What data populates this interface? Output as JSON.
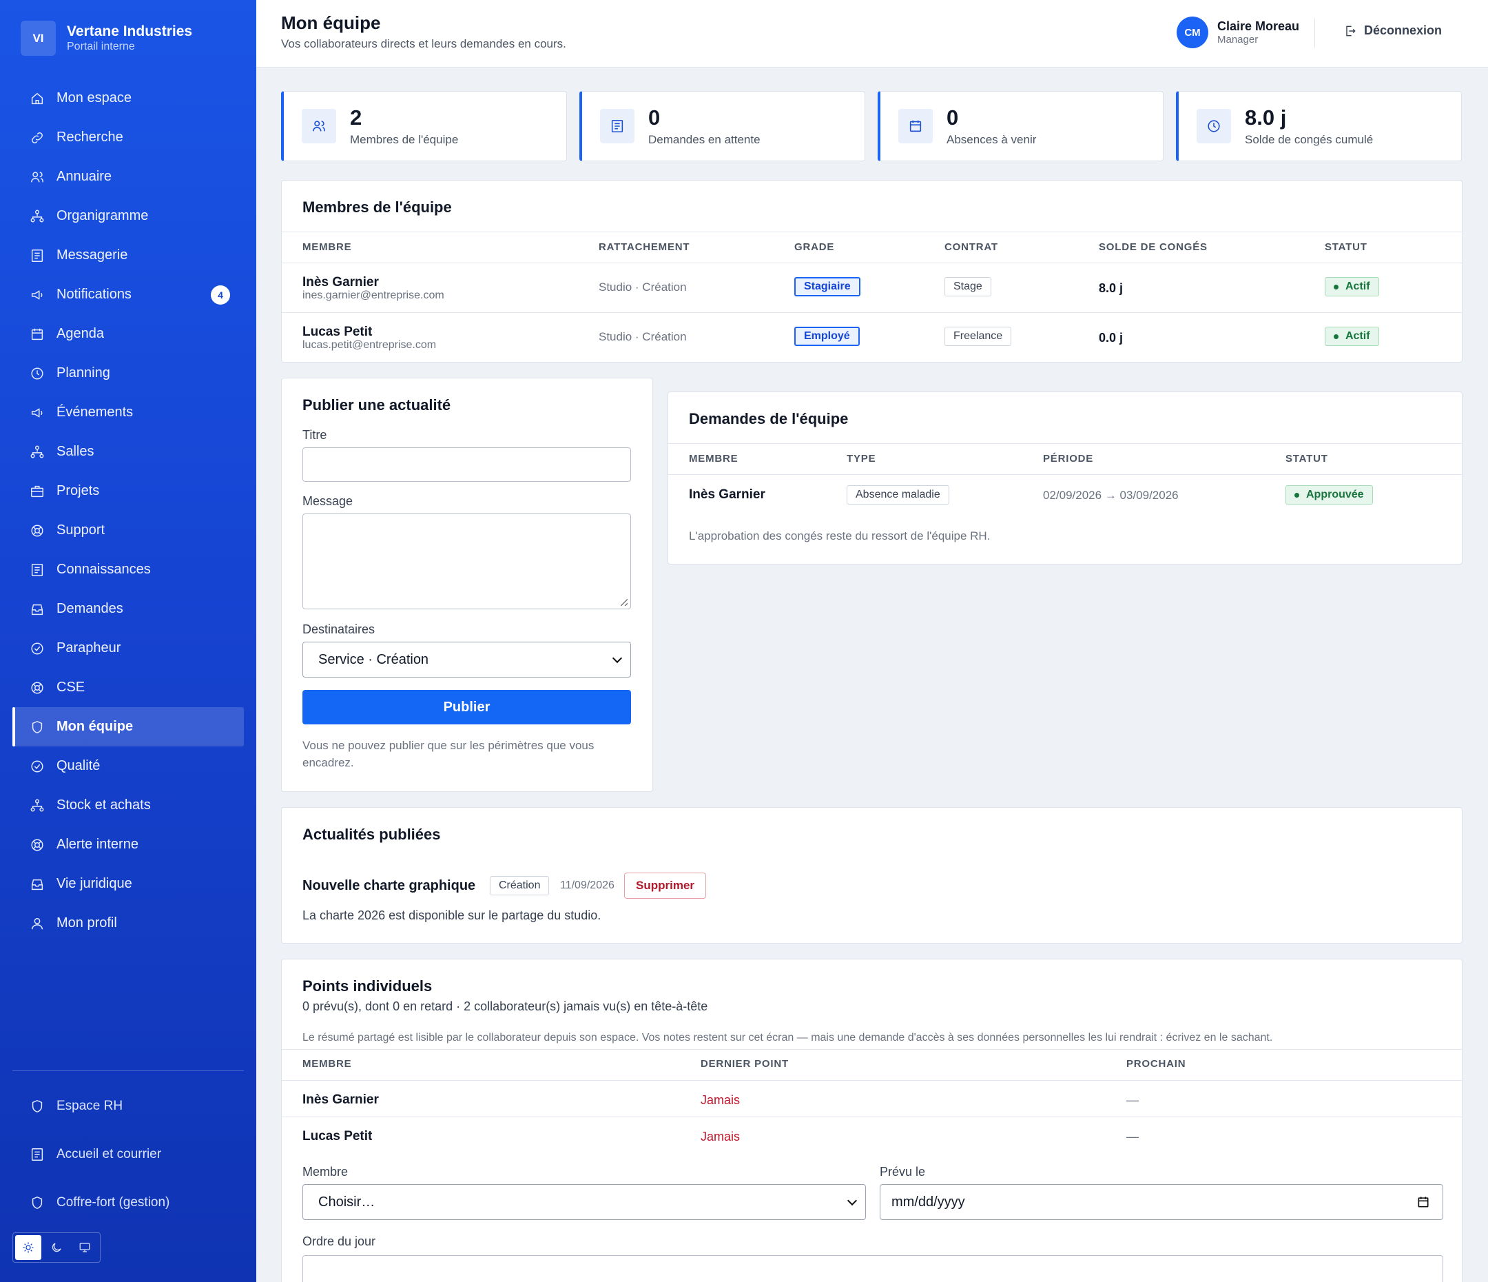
{
  "brand": {
    "initials": "VI",
    "name": "Vertane Industries",
    "subtitle": "Portail interne"
  },
  "sidebar": {
    "items": [
      {
        "label": "Mon espace",
        "icon": "home-icon"
      },
      {
        "label": "Recherche",
        "icon": "link-icon"
      },
      {
        "label": "Annuaire",
        "icon": "users-icon"
      },
      {
        "label": "Organigramme",
        "icon": "org-chart-icon"
      },
      {
        "label": "Messagerie",
        "icon": "document-icon"
      },
      {
        "label": "Notifications",
        "icon": "megaphone-icon",
        "badge": "4"
      },
      {
        "label": "Agenda",
        "icon": "calendar-icon"
      },
      {
        "label": "Planning",
        "icon": "clock-icon"
      },
      {
        "label": "Événements",
        "icon": "megaphone-icon"
      },
      {
        "label": "Salles",
        "icon": "org-chart-icon"
      },
      {
        "label": "Projets",
        "icon": "briefcase-icon"
      },
      {
        "label": "Support",
        "icon": "lifebuoy-icon"
      },
      {
        "label": "Connaissances",
        "icon": "document-icon"
      },
      {
        "label": "Demandes",
        "icon": "inbox-icon"
      },
      {
        "label": "Parapheur",
        "icon": "check-circle-icon"
      },
      {
        "label": "CSE",
        "icon": "lifebuoy-icon"
      },
      {
        "label": "Mon équipe",
        "icon": "shield-icon",
        "active": true
      },
      {
        "label": "Qualité",
        "icon": "check-circle-icon"
      },
      {
        "label": "Stock et achats",
        "icon": "org-chart-icon"
      },
      {
        "label": "Alerte interne",
        "icon": "lifebuoy-icon"
      },
      {
        "label": "Vie juridique",
        "icon": "inbox-icon"
      },
      {
        "label": "Mon profil",
        "icon": "user-icon"
      }
    ],
    "bottom_items": [
      {
        "label": "Espace RH",
        "icon": "shield-icon"
      },
      {
        "label": "Accueil et courrier",
        "icon": "document-icon"
      },
      {
        "label": "Coffre-fort (gestion)",
        "icon": "shield-icon"
      }
    ],
    "theme_options": [
      "sun-icon",
      "moon-icon",
      "monitor-icon"
    ]
  },
  "header": {
    "title": "Mon équipe",
    "subtitle": "Vos collaborateurs directs et leurs demandes en cours.",
    "user": {
      "initials": "CM",
      "name": "Claire Moreau",
      "role": "Manager"
    },
    "logout_label": "Déconnexion"
  },
  "stats": [
    {
      "value": "2",
      "label": "Membres de l'équipe",
      "icon": "users-icon"
    },
    {
      "value": "0",
      "label": "Demandes en attente",
      "icon": "document-icon"
    },
    {
      "value": "0",
      "label": "Absences à venir",
      "icon": "calendar-icon"
    },
    {
      "value": "8.0 j",
      "label": "Solde de congés cumulé",
      "icon": "clock-icon"
    }
  ],
  "team": {
    "title": "Membres de l'équipe",
    "columns": [
      "Membre",
      "Rattachement",
      "Grade",
      "Contrat",
      "Solde de congés",
      "Statut"
    ],
    "rows": [
      {
        "name": "Inès Garnier",
        "email": "ines.garnier@entreprise.com",
        "attachment": "Studio · Création",
        "grade": "Stagiaire",
        "contract": "Stage",
        "balance": "8.0 j",
        "status": "Actif"
      },
      {
        "name": "Lucas Petit",
        "email": "lucas.petit@entreprise.com",
        "attachment": "Studio · Création",
        "grade": "Employé",
        "contract": "Freelance",
        "balance": "0.0 j",
        "status": "Actif"
      }
    ]
  },
  "publish": {
    "title": "Publier une actualité",
    "title_label": "Titre",
    "title_value": "",
    "message_label": "Message",
    "message_value": "",
    "recipients_label": "Destinataires",
    "recipients_value": "Service · Création",
    "submit_label": "Publier",
    "hint": "Vous ne pouvez publier que sur les périmètres que vous encadrez."
  },
  "requests": {
    "title": "Demandes de l'équipe",
    "columns": [
      "Membre",
      "Type",
      "Période",
      "Statut"
    ],
    "rows": [
      {
        "member": "Inès Garnier",
        "type": "Absence maladie",
        "period": "02/09/2026 → 03/09/2026",
        "status": "Approuvée"
      }
    ],
    "note": "L'approbation des congés reste du ressort de l'équipe RH."
  },
  "news": {
    "title": "Actualités publiées",
    "items": [
      {
        "title": "Nouvelle charte graphique",
        "tag": "Création",
        "date": "11/09/2026",
        "delete_label": "Supprimer",
        "body": "La charte 2026 est disponible sur le partage du studio."
      }
    ]
  },
  "one_on_ones": {
    "title": "Points individuels",
    "summary": "0 prévu(s), dont 0 en retard · 2 collaborateur(s) jamais vu(s) en tête-à-tête",
    "notice": "Le résumé partagé est lisible par le collaborateur depuis son espace. Vos notes restent sur cet écran — mais une demande d'accès à ses données personnelles les lui rendrait : écrivez en le sachant.",
    "columns": [
      "Membre",
      "Dernier point",
      "Prochain"
    ],
    "rows": [
      {
        "member": "Inès Garnier",
        "last": "Jamais",
        "next": "—"
      },
      {
        "member": "Lucas Petit",
        "last": "Jamais",
        "next": "—"
      }
    ],
    "form": {
      "member_label": "Membre",
      "member_value": "Choisir…",
      "date_label": "Prévu le",
      "date_placeholder": "mm/dd/yyyy",
      "agenda_label": "Ordre du jour"
    }
  }
}
